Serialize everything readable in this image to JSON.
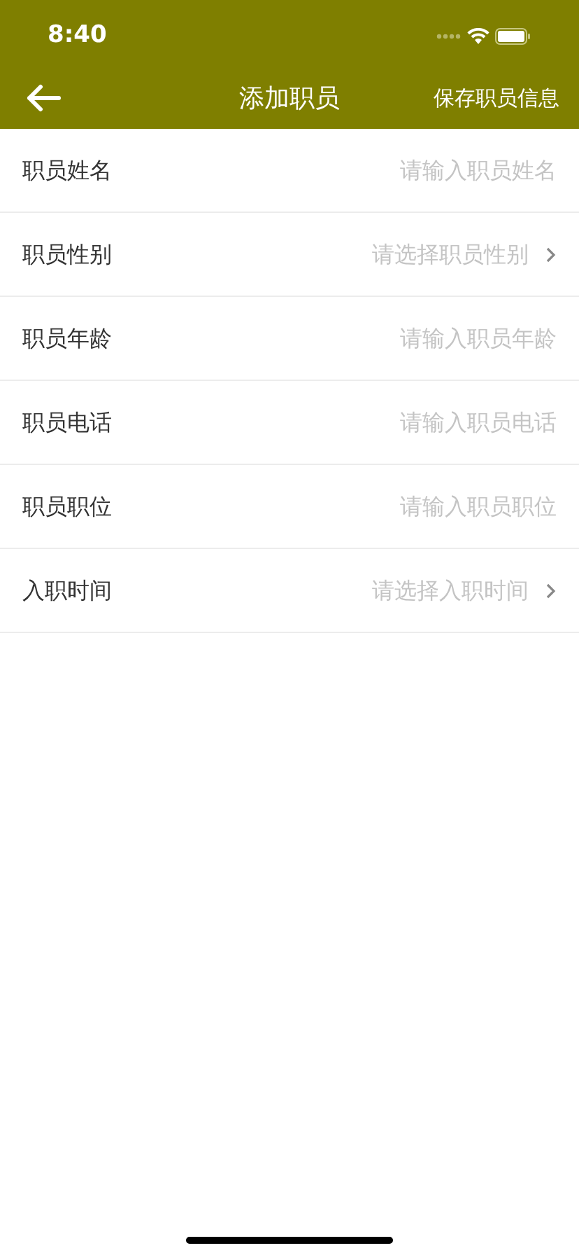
{
  "status_bar": {
    "time": "8:40"
  },
  "nav": {
    "title": "添加职员",
    "action": "保存职员信息"
  },
  "fields": [
    {
      "kind": "input",
      "label": "职员姓名",
      "placeholder": "请输入职员姓名"
    },
    {
      "kind": "select",
      "label": "职员性别",
      "placeholder": "请选择职员性别"
    },
    {
      "kind": "input",
      "label": "职员年龄",
      "placeholder": "请输入职员年龄"
    },
    {
      "kind": "input",
      "label": "职员电话",
      "placeholder": "请输入职员电话"
    },
    {
      "kind": "input",
      "label": "职员职位",
      "placeholder": "请输入职员职位"
    },
    {
      "kind": "select",
      "label": "入职时间",
      "placeholder": "请选择入职时间"
    }
  ]
}
